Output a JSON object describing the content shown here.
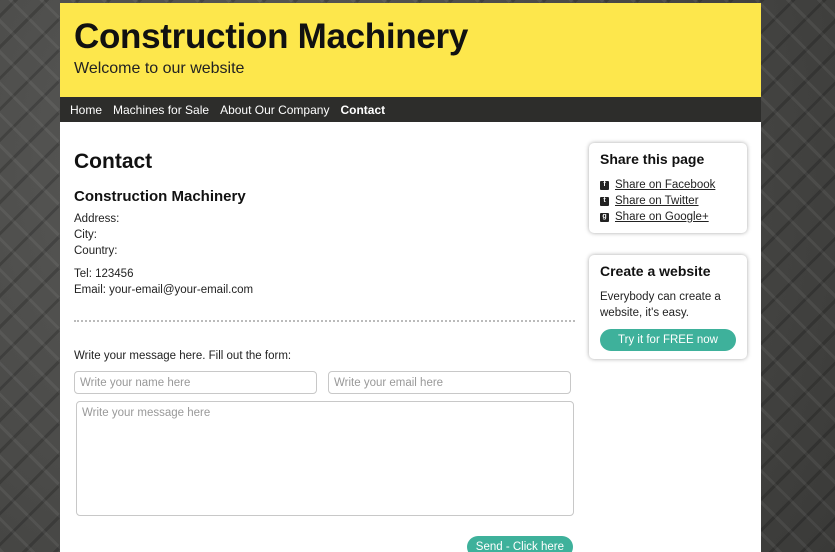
{
  "header": {
    "title": "Construction Machinery",
    "subtitle": "Welcome to our website"
  },
  "nav": {
    "items": [
      {
        "label": "Home"
      },
      {
        "label": "Machines for Sale"
      },
      {
        "label": "About Our Company"
      },
      {
        "label": "Contact"
      }
    ]
  },
  "main": {
    "heading": "Contact",
    "company": "Construction Machinery",
    "address_label": "Address:",
    "city_label": "City:",
    "country_label": "Country:",
    "tel": "Tel: 123456",
    "email": "Email: your-email@your-email.com",
    "form_intro": "Write your message here. Fill out the form:",
    "name_placeholder": "Write your name here",
    "email_placeholder": "Write your email here",
    "message_placeholder": "Write your message here",
    "send_label": "Send - Click here"
  },
  "sidebar": {
    "share_title": "Share this page",
    "share_items": [
      {
        "icon": "f",
        "label": "Share on Facebook"
      },
      {
        "icon": "t",
        "label": "Share on Twitter"
      },
      {
        "icon": "g+",
        "label": "Share on Google+"
      }
    ],
    "create_title": "Create a website",
    "create_text": "Everybody can create a website, it's easy.",
    "create_button": "Try it for FREE now"
  },
  "colors": {
    "header_bg": "#fde74c",
    "nav_bg": "#2d2d2b",
    "accent": "#3eb19b"
  }
}
